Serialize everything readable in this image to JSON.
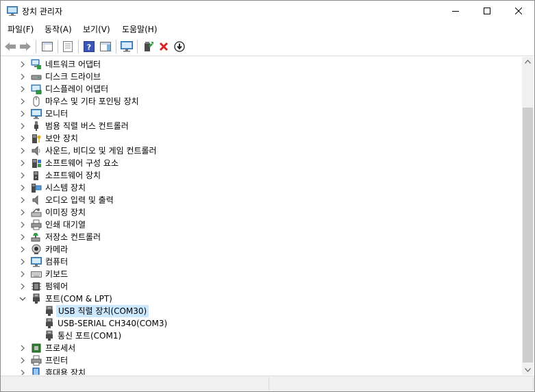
{
  "window": {
    "title": "장치 관리자"
  },
  "menu": [
    {
      "label": "파일(F)"
    },
    {
      "label": "동작(A)"
    },
    {
      "label": "보기(V)"
    },
    {
      "label": "도움말(H)"
    }
  ],
  "tree": {
    "categories": [
      {
        "label": "네트워크 어댑터",
        "icon": "network-adapter-icon",
        "expanded": false
      },
      {
        "label": "디스크 드라이브",
        "icon": "disk-drive-icon",
        "expanded": false
      },
      {
        "label": "디스플레이 어댑터",
        "icon": "display-adapter-icon",
        "expanded": false
      },
      {
        "label": "마우스 및 기타 포인팅 장치",
        "icon": "mouse-icon",
        "expanded": false
      },
      {
        "label": "모니터",
        "icon": "monitor-icon",
        "expanded": false
      },
      {
        "label": "범용 직렬 버스 컨트롤러",
        "icon": "usb-controller-icon",
        "expanded": false
      },
      {
        "label": "보안 장치",
        "icon": "security-device-icon",
        "expanded": false
      },
      {
        "label": "사운드, 비디오 및 게임 컨트롤러",
        "icon": "speaker-icon",
        "expanded": false
      },
      {
        "label": "소프트웨어 구성 요소",
        "icon": "software-component-icon",
        "expanded": false
      },
      {
        "label": "소프트웨어 장치",
        "icon": "software-device-icon",
        "expanded": false
      },
      {
        "label": "시스템 장치",
        "icon": "system-device-icon",
        "expanded": false
      },
      {
        "label": "오디오 입력 및 출력",
        "icon": "audio-io-icon",
        "expanded": false
      },
      {
        "label": "이미징 장치",
        "icon": "imaging-device-icon",
        "expanded": false
      },
      {
        "label": "인쇄 대기열",
        "icon": "print-queue-icon",
        "expanded": false
      },
      {
        "label": "저장소 컨트롤러",
        "icon": "storage-controller-icon",
        "expanded": false
      },
      {
        "label": "카메라",
        "icon": "camera-icon",
        "expanded": false
      },
      {
        "label": "컴퓨터",
        "icon": "computer-icon",
        "expanded": false
      },
      {
        "label": "키보드",
        "icon": "keyboard-icon",
        "expanded": false
      },
      {
        "label": "펌웨어",
        "icon": "firmware-icon",
        "expanded": false
      },
      {
        "label": "포트(COM & LPT)",
        "icon": "port-icon",
        "expanded": true,
        "children": [
          {
            "label": "USB 직렬 장치(COM30)",
            "icon": "port-icon",
            "selected": true
          },
          {
            "label": "USB-SERIAL CH340(COM3)",
            "icon": "port-icon",
            "selected": false
          },
          {
            "label": "통신 포트(COM1)",
            "icon": "port-icon",
            "selected": false
          }
        ]
      },
      {
        "label": "프로세서",
        "icon": "processor-icon",
        "expanded": false
      },
      {
        "label": "프린터",
        "icon": "printer-icon",
        "expanded": false
      },
      {
        "label": "휴대용 장치",
        "icon": "portable-device-icon",
        "expanded": false
      }
    ]
  }
}
